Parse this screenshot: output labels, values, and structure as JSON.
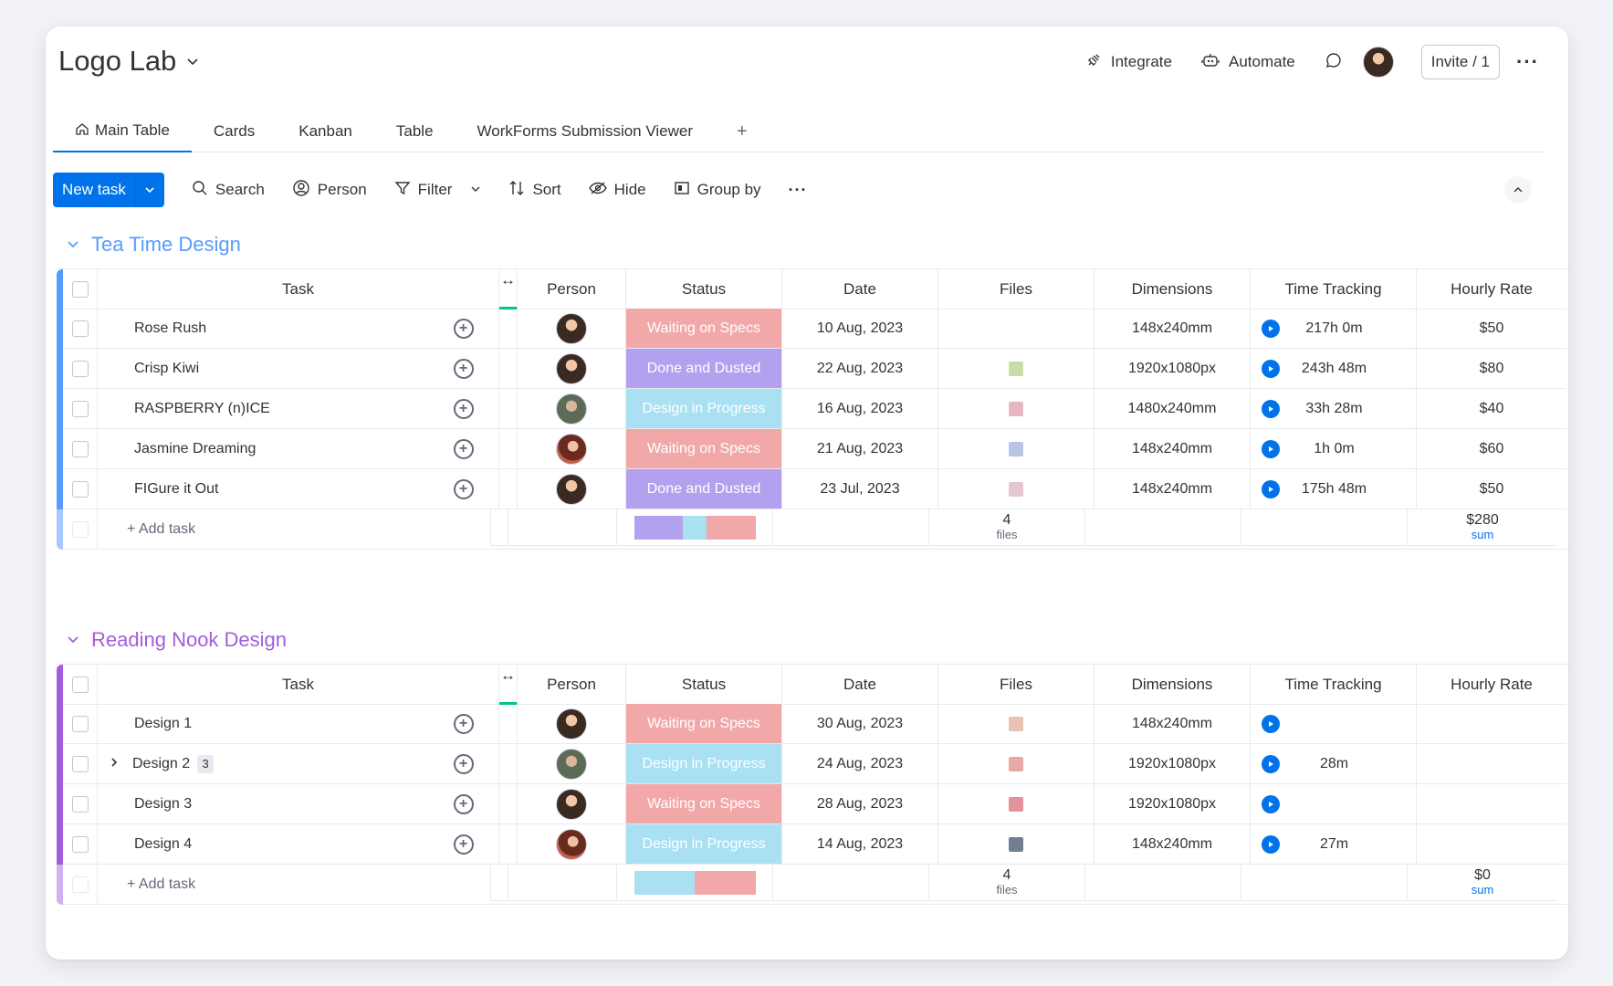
{
  "board": {
    "title": "Logo Lab"
  },
  "header": {
    "integrate": "Integrate",
    "automate": "Automate",
    "invite": "Invite / 1"
  },
  "tabs": [
    {
      "label": "Main Table",
      "icon": "home-icon",
      "active": true
    },
    {
      "label": "Cards"
    },
    {
      "label": "Kanban"
    },
    {
      "label": "Table"
    },
    {
      "label": "WorkForms Submission Viewer"
    }
  ],
  "toolbar": {
    "new_task": "New task",
    "search": "Search",
    "person": "Person",
    "filter": "Filter",
    "sort": "Sort",
    "hide": "Hide",
    "group_by": "Group by"
  },
  "columns": {
    "task": "Task",
    "person": "Person",
    "status": "Status",
    "date": "Date",
    "files": "Files",
    "dimensions": "Dimensions",
    "time_tracking": "Time Tracking",
    "hourly_rate": "Hourly Rate"
  },
  "colors": {
    "accent": "#0073ea",
    "waiting": "#f2a8a8",
    "done": "#b3a1f0",
    "progress": "#a9e0f2",
    "group1": "#579bfc",
    "group2": "#a25ddc"
  },
  "add_task": "+ Add task",
  "groups": [
    {
      "title": "Tea Time Design",
      "rows": [
        {
          "name": "Rose Rush",
          "status": "Waiting on Specs",
          "date": "10 Aug, 2023",
          "dim": "148x240mm",
          "time": "217h 0m",
          "rate": "$50"
        },
        {
          "name": "Crisp Kiwi",
          "status": "Done and Dusted",
          "date": "22 Aug, 2023",
          "dim": "1920x1080px",
          "time": "243h 48m",
          "rate": "$80"
        },
        {
          "name": "RASPBERRY (n)ICE",
          "status": "Design in Progress",
          "date": "16 Aug, 2023",
          "dim": "1480x240mm",
          "time": "33h 28m",
          "rate": "$40"
        },
        {
          "name": "Jasmine Dreaming",
          "status": "Waiting on Specs",
          "date": "21 Aug, 2023",
          "dim": "148x240mm",
          "time": "1h 0m",
          "rate": "$60"
        },
        {
          "name": "FIGure it Out",
          "status": "Done and Dusted",
          "date": "23 Jul, 2023",
          "dim": "148x240mm",
          "time": "175h 48m",
          "rate": "$50"
        }
      ],
      "summary": {
        "files_count": "4",
        "files_unit": "files",
        "rate_sum": "$280",
        "rate_unit": "sum"
      }
    },
    {
      "title": "Reading Nook Design",
      "rows": [
        {
          "name": "Design 1",
          "status": "Waiting on Specs",
          "date": "30 Aug, 2023",
          "dim": "148x240mm",
          "time": "",
          "rate": ""
        },
        {
          "name": "Design 2",
          "subitems": "3",
          "status": "Design in Progress",
          "date": "24 Aug, 2023",
          "dim": "1920x1080px",
          "time": "28m",
          "rate": ""
        },
        {
          "name": "Design 3",
          "status": "Waiting on Specs",
          "date": "28 Aug, 2023",
          "dim": "1920x1080px",
          "time": "",
          "rate": ""
        },
        {
          "name": "Design 4",
          "status": "Design in Progress",
          "date": "14 Aug, 2023",
          "dim": "148x240mm",
          "time": "27m",
          "rate": ""
        }
      ],
      "summary": {
        "files_count": "4",
        "files_unit": "files",
        "rate_sum": "$0",
        "rate_unit": "sum"
      }
    }
  ]
}
